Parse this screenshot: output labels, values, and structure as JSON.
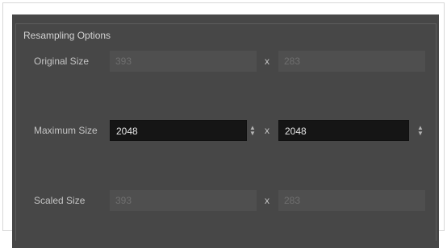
{
  "group": {
    "title": "Resampling Options"
  },
  "original_size": {
    "label": "Original Size",
    "width": "393",
    "height": "283"
  },
  "maximum_size": {
    "label": "Maximum Size",
    "width": "2048",
    "height": "2048"
  },
  "scaled_size": {
    "label": "Scaled Size",
    "width": "393",
    "height": "283"
  },
  "separator": "x",
  "colors": {
    "panel_background": "#474747",
    "active_field": "#151515",
    "disabled_field": "#4f4f4f"
  },
  "icons": {
    "spinner": "up-down-spinner-arrows-icon"
  }
}
